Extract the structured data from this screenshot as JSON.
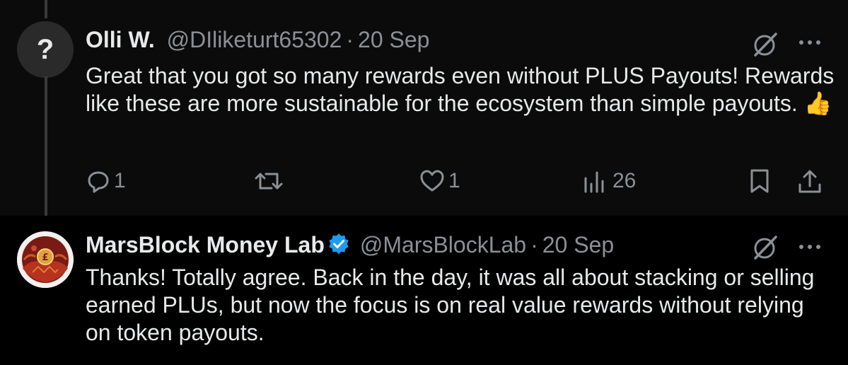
{
  "tweets": [
    {
      "avatar_icon": "question-mark",
      "avatar_text": "?",
      "name": "Olli W.",
      "handle": "@DIliketurt65302",
      "separator": "·",
      "date": "20 Sep",
      "text": "Great that you got so many rewards even without PLUS Payouts! Rewards like these are more sustainable for the ecosystem than simple payouts. 👍",
      "actions": {
        "reply_count": "1",
        "retweet_count": "",
        "like_count": "1",
        "views_count": "26"
      }
    },
    {
      "avatar_icon": "marsblock-logo",
      "name": "MarsBlock Money Lab",
      "verified": true,
      "handle": "@MarsBlockLab",
      "separator": "·",
      "date": "20 Sep",
      "text": "Thanks! Totally agree. Back in the day, it was all about stacking or selling earned PLUs, but now the focus is on real value rewards without relying on token payouts."
    }
  ],
  "colors": {
    "background": "#000000",
    "text": "#e7e9ea",
    "muted": "#8b9096",
    "verified": "#1d9bf0"
  }
}
